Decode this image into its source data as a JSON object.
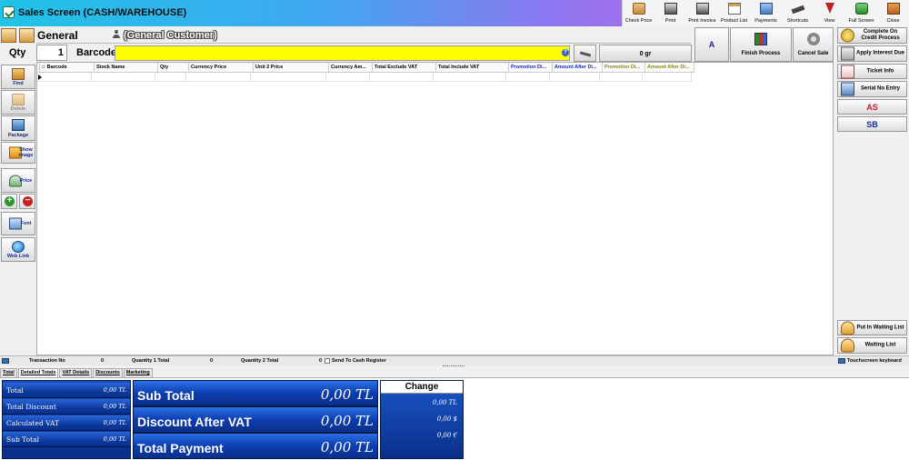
{
  "window": {
    "title": "Sales Screen (CASH/WAREHOUSE)"
  },
  "toolbar": {
    "buttons": [
      {
        "label": "Check Price",
        "icon": "check-price-icon"
      },
      {
        "label": "Print",
        "icon": "printer-icon"
      },
      {
        "label": "Print Invoice",
        "icon": "print-invoice-icon"
      },
      {
        "label": "Product List",
        "icon": "product-list-icon"
      },
      {
        "label": "Payments",
        "icon": "payments-icon"
      },
      {
        "label": "Shortcuts",
        "icon": "shortcuts-icon"
      },
      {
        "label": "View",
        "icon": "view-icon"
      },
      {
        "label": "Full Screen",
        "icon": "full-screen-icon"
      },
      {
        "label": "Close",
        "icon": "close-door-icon"
      }
    ]
  },
  "customer": {
    "name": "General",
    "description": "(General Customer)"
  },
  "entry": {
    "qty_label": "Qty",
    "qty_value": "1",
    "barcode_label": "Barcode",
    "barcode_value": "",
    "help": "?",
    "weight": "0 gr"
  },
  "actions": {
    "a_label": "A",
    "finish_label": "Finish Process",
    "cancel_label": "Cancel Sale"
  },
  "left_buttons": {
    "find": "Find",
    "delete": "Delete",
    "package": "Package",
    "show_image": "Show Image",
    "price": "Price",
    "plus": "+",
    "minus": "−",
    "font": "Font",
    "web_link": "Web Link"
  },
  "grid": {
    "row_marker": "::",
    "columns": [
      {
        "label": "Barcode",
        "color": "#000000"
      },
      {
        "label": "Stock Name",
        "color": "#000000"
      },
      {
        "label": "Qty",
        "color": "#000000"
      },
      {
        "label": "Currency Price",
        "color": "#000000"
      },
      {
        "label": "Unit 2 Price",
        "color": "#000000"
      },
      {
        "label": "Currency Am...",
        "color": "#000000"
      },
      {
        "label": "Total Exclude VAT",
        "color": "#000000"
      },
      {
        "label": "Total Include VAT",
        "color": "#000000"
      },
      {
        "label": "Promotion Di...",
        "color": "#1a2ab8"
      },
      {
        "label": "Amount After Di...",
        "color": "#1a2ab8"
      },
      {
        "label": "Promotion Di...",
        "color": "#8a8a10"
      },
      {
        "label": "Amount After Di...",
        "color": "#8a8a10"
      }
    ]
  },
  "right_buttons": {
    "complete_on_credit": "Complete On Credit Process",
    "apply_interest": "Apply Interest Due",
    "ticket_info": "Ticket Info",
    "serial_no_entry": "Serial No Entry",
    "as": "AS",
    "sb": "SB",
    "put_waiting": "Put In Waiting List",
    "waiting_list": "Waiting List"
  },
  "status": {
    "transaction_label": "Transaction No",
    "transaction_value": "0",
    "qty1_label": "Quantity 1 Total",
    "qty1_value": "0",
    "qty2_label": "Quantity 2 Total",
    "qty2_value": "0",
    "send_register": "Send To Cash Register",
    "touchscreen": "Touchscreen keyboard"
  },
  "tabs": [
    "Total",
    "Detailed Totals",
    "VAT Details",
    "Discounts",
    "Marketing"
  ],
  "totals": {
    "small": [
      {
        "label": "Total",
        "value": "0,00 TL"
      },
      {
        "label": "Total Discount",
        "value": "0,00 TL"
      },
      {
        "label": "Calculated VAT",
        "value": "0,00 TL"
      },
      {
        "label": "Sub Total",
        "value": "0,00 TL"
      }
    ],
    "big": [
      {
        "label": "Sub Total",
        "value": "0,00 TL"
      },
      {
        "label": "Discount After VAT",
        "value": "0,00 TL"
      },
      {
        "label": "Total Payment",
        "value": "0,00 TL"
      }
    ],
    "change": {
      "title": "Change",
      "tl": "0,00 TL",
      "usd": "0,00 $",
      "eur": "0,00 €"
    }
  }
}
